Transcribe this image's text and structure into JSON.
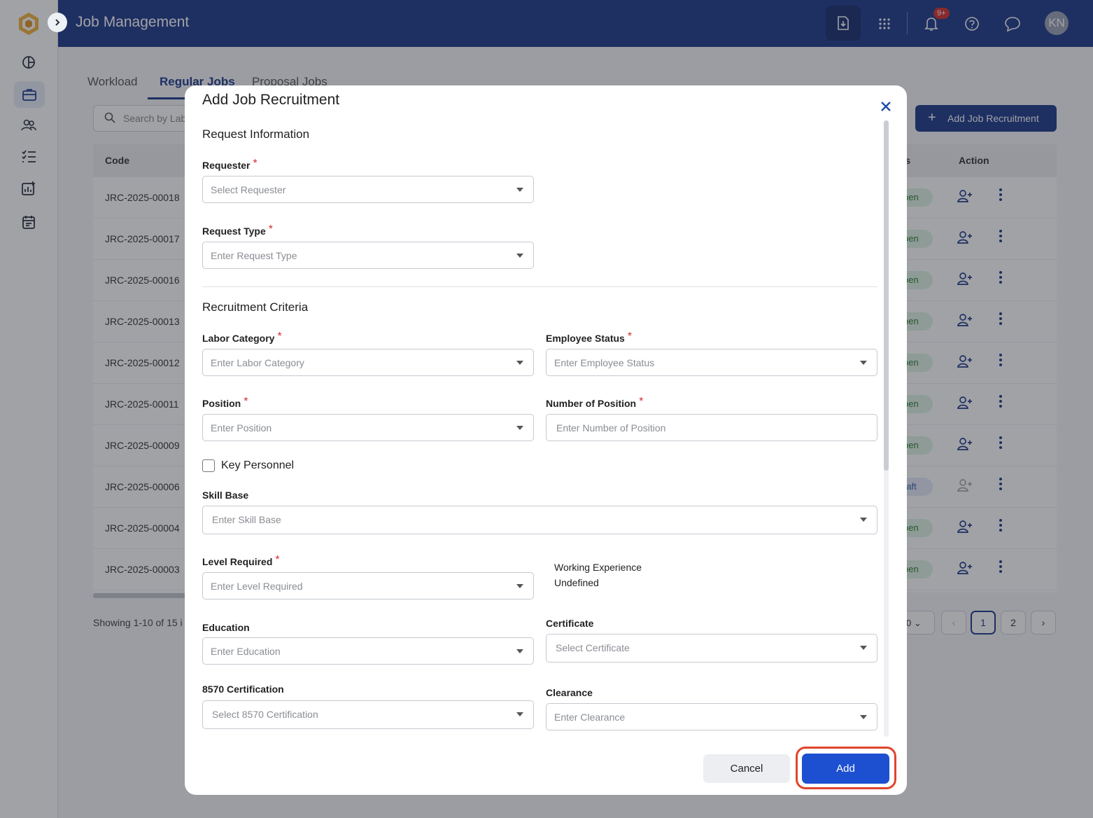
{
  "app": {
    "title": "Job Management",
    "notification_badge": "9+",
    "avatar_initials": "KN"
  },
  "tabs": [
    "Workload",
    "Regular Jobs",
    "Proposal Jobs"
  ],
  "search": {
    "placeholder": "Search by Lab"
  },
  "add_button_label": "Add Job Recruitment",
  "table": {
    "headers": {
      "code": "Code",
      "status": "tus",
      "action": "Action"
    },
    "rows": [
      {
        "code": "JRC-2025-00018",
        "status": "pen"
      },
      {
        "code": "JRC-2025-00017",
        "status": "pen"
      },
      {
        "code": "JRC-2025-00016",
        "status": "pen"
      },
      {
        "code": "JRC-2025-00013",
        "status": "pen"
      },
      {
        "code": "JRC-2025-00012",
        "status": "pen"
      },
      {
        "code": "JRC-2025-00011",
        "status": "pen"
      },
      {
        "code": "JRC-2025-00009",
        "status": "pen"
      },
      {
        "code": "JRC-2025-00006",
        "status": "raft"
      },
      {
        "code": "JRC-2025-00004",
        "status": "pen"
      },
      {
        "code": "JRC-2025-00003",
        "status": "pen"
      }
    ]
  },
  "pagination": {
    "showing": "Showing 1-10 of 15 i",
    "page_size": "0",
    "pages": [
      "1",
      "2"
    ]
  },
  "modal": {
    "title": "Add Job Recruitment",
    "sections": {
      "request_info": "Request Information",
      "criteria": "Recruitment Criteria"
    },
    "fields": {
      "requester": {
        "label": "Requester",
        "placeholder": "Select Requester"
      },
      "request_type": {
        "label": "Request Type",
        "placeholder": "Enter Request Type"
      },
      "labor_category": {
        "label": "Labor Category",
        "placeholder": "Enter Labor Category"
      },
      "employee_status": {
        "label": "Employee Status",
        "placeholder": "Enter Employee Status"
      },
      "position": {
        "label": "Position",
        "placeholder": "Enter Position"
      },
      "number_of_position": {
        "label": "Number of Position",
        "placeholder": "Enter Number of Position"
      },
      "key_personnel": {
        "label": "Key Personnel"
      },
      "skill_base": {
        "label": "Skill Base",
        "placeholder": "Enter Skill Base"
      },
      "level_required": {
        "label": "Level Required",
        "placeholder": "Enter Level Required"
      },
      "working_experience": {
        "label": "Working Experience",
        "value": "Undefined"
      },
      "education": {
        "label": "Education",
        "placeholder": "Enter Education"
      },
      "certificate": {
        "label": "Certificate",
        "placeholder": "Select Certificate"
      },
      "cert_8570": {
        "label": "8570 Certification",
        "placeholder": "Select 8570 Certification"
      },
      "clearance": {
        "label": "Clearance",
        "placeholder": "Enter Clearance"
      }
    },
    "buttons": {
      "cancel": "Cancel",
      "add": "Add"
    },
    "required_mark": "*"
  },
  "colors": {
    "brand": "#1e3a8a",
    "primary_button": "#1d4fd1",
    "required": "#d32f2f",
    "highlight": "#e0452b"
  }
}
